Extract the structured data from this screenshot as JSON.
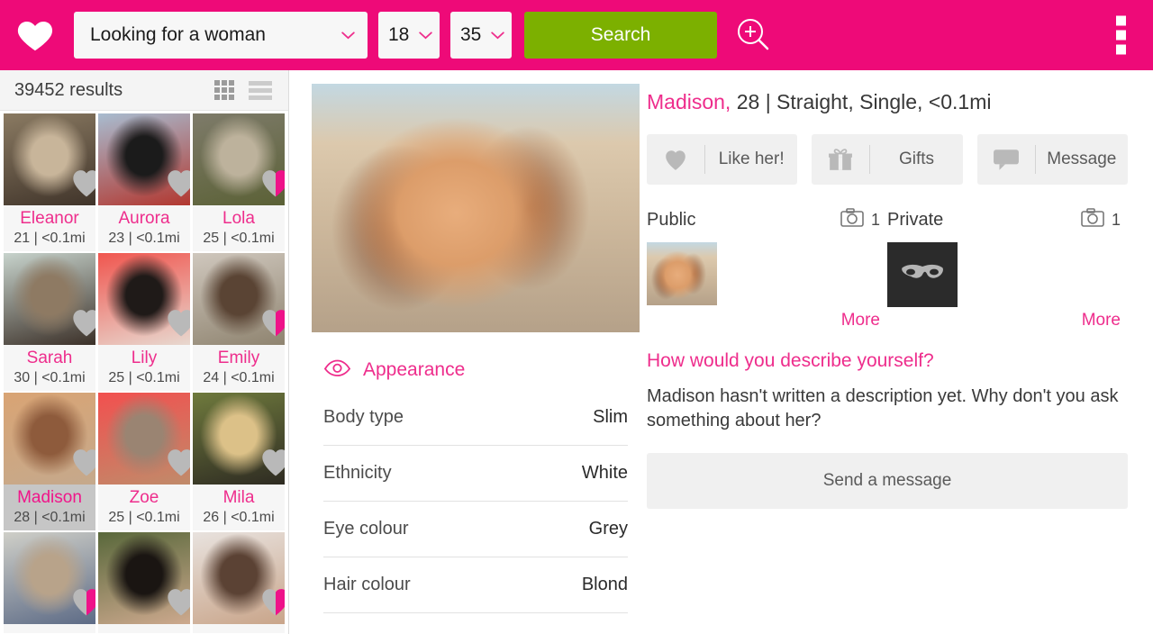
{
  "header": {
    "logo_icon": "heart-logo-icon",
    "looking_for": "Looking for a woman",
    "age_min": "18",
    "age_max": "35",
    "search_label": "Search",
    "advanced_search_icon": "magnifier-plus-icon",
    "overflow_icon": "overflow-menu-icon",
    "brand_color": "#ee0a78",
    "search_button_color": "#7cb000"
  },
  "sidebar": {
    "results_text": "39452 results",
    "grid_view_icon": "grid-view-icon",
    "list_view_icon": "list-view-icon",
    "cards": [
      {
        "name": "Eleanor",
        "meta": "21 | <0.1mi",
        "liked": false,
        "selected": false,
        "img_a": "#8a7a62",
        "img_b": "#c8b59a",
        "img_c": "#40342a"
      },
      {
        "name": "Aurora",
        "meta": "23 | <0.1mi",
        "liked": false,
        "selected": false,
        "img_a": "#a8bcd0",
        "img_b": "#1b1b1b",
        "img_c": "#b2372f"
      },
      {
        "name": "Lola",
        "meta": "25 | <0.1mi",
        "liked": true,
        "selected": false,
        "img_a": "#7e7b6a",
        "img_b": "#bdb29c",
        "img_c": "#5b6136"
      },
      {
        "name": "Sarah",
        "meta": "30 | <0.1mi",
        "liked": false,
        "selected": false,
        "img_a": "#c7d3cc",
        "img_b": "#8e7a63",
        "img_c": "#3b3028"
      },
      {
        "name": "Lily",
        "meta": "25 | <0.1mi",
        "liked": false,
        "selected": false,
        "img_a": "#f0564f",
        "img_b": "#1f1a18",
        "img_c": "#e8d8cf"
      },
      {
        "name": "Emily",
        "meta": "24 | <0.1mi",
        "liked": true,
        "selected": false,
        "img_a": "#cfc7bd",
        "img_b": "#5a4434",
        "img_c": "#8f8470"
      },
      {
        "name": "Madison",
        "meta": "28 | <0.1mi",
        "liked": false,
        "selected": true,
        "img_a": "#d9a474",
        "img_b": "#8e5b3c",
        "img_c": "#c5a98c"
      },
      {
        "name": "Zoe",
        "meta": "25 | <0.1mi",
        "liked": false,
        "selected": false,
        "img_a": "#f2504f",
        "img_b": "#9a8472",
        "img_c": "#c08b6a"
      },
      {
        "name": "Mila",
        "meta": "26 | <0.1mi",
        "liked": false,
        "selected": false,
        "img_a": "#6f7a3d",
        "img_b": "#dcc188",
        "img_c": "#2e2b22"
      },
      {
        "name": "",
        "meta": "",
        "liked": true,
        "selected": false,
        "img_a": "#cfcfc8",
        "img_b": "#b8a38a",
        "img_c": "#5d6b86"
      },
      {
        "name": "",
        "meta": "",
        "liked": false,
        "selected": false,
        "img_a": "#59683b",
        "img_b": "#1a1512",
        "img_c": "#cda98e"
      },
      {
        "name": "",
        "meta": "",
        "liked": true,
        "selected": false,
        "img_a": "#e8e2de",
        "img_b": "#5b4234",
        "img_c": "#c9a58a"
      }
    ]
  },
  "appearance": {
    "icon": "eye-icon",
    "title": "Appearance",
    "rows": [
      {
        "key": "Body type",
        "value": "Slim"
      },
      {
        "key": "Ethnicity",
        "value": "White"
      },
      {
        "key": "Eye colour",
        "value": "Grey"
      },
      {
        "key": "Hair colour",
        "value": "Blond"
      }
    ]
  },
  "profile": {
    "name": "Madison,",
    "details": " 28 | Straight, Single, <0.1mi",
    "hero_photo_alt": "madison-main-photo",
    "actions": [
      {
        "icon": "heart-icon",
        "label": "Like her!"
      },
      {
        "icon": "gift-icon",
        "label": "Gifts"
      },
      {
        "icon": "chat-bubble-icon",
        "label": "Message"
      }
    ],
    "photos": {
      "public_label": "Public",
      "public_count": "1",
      "private_label": "Private",
      "private_count": "1",
      "camera_icon": "camera-icon",
      "mask_icon": "mask-icon",
      "more_label": "More"
    },
    "description": {
      "question": "How would you describe yourself?",
      "body": "Madison hasn't written a description yet. Why don't you ask something about her?",
      "send_label": "Send a message"
    }
  }
}
